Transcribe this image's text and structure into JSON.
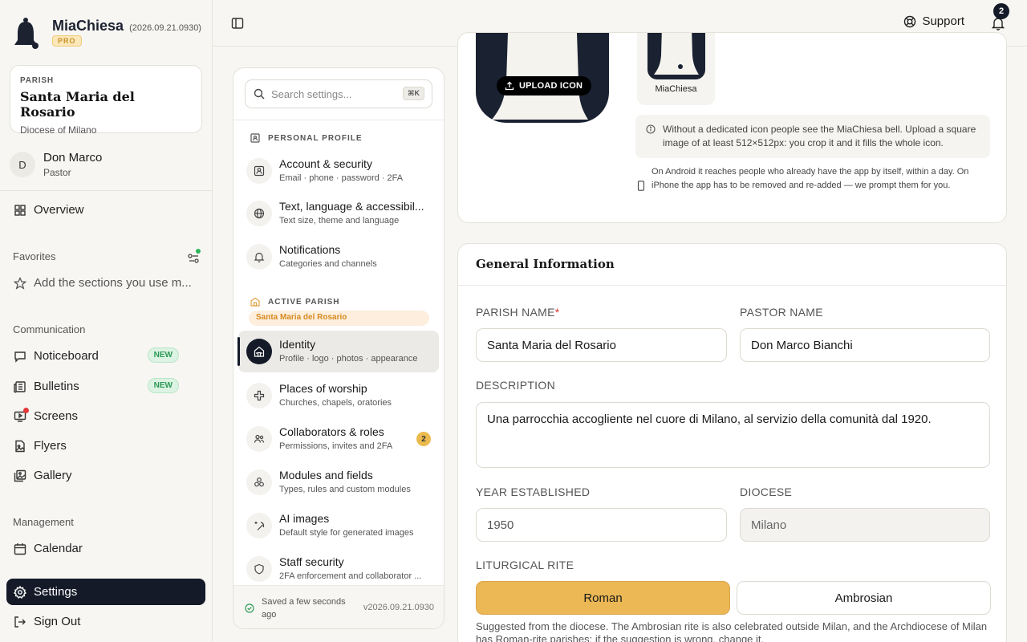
{
  "brand": {
    "name": "MiaChiesa",
    "version": "(2026.09.21.0930)",
    "badge": "PRO"
  },
  "parish_card": {
    "label": "PARISH",
    "name": "Santa Maria del Rosario",
    "diocese": "Diocese of Milano"
  },
  "user": {
    "initial": "D",
    "name": "Don Marco",
    "role": "Pastor"
  },
  "nav": {
    "overview": "Overview",
    "favorites_label": "Favorites",
    "favorites_hint": "Add the sections you use m...",
    "communication_label": "Communication",
    "noticeboard": "Noticeboard",
    "bulletins": "Bulletins",
    "new_badge": "NEW",
    "screens": "Screens",
    "flyers": "Flyers",
    "gallery": "Gallery",
    "management_label": "Management",
    "calendar": "Calendar",
    "settings": "Settings",
    "sign_out": "Sign Out"
  },
  "topbar": {
    "support": "Support",
    "notification_count": "2"
  },
  "settings_panel": {
    "search_placeholder": "Search settings...",
    "search_shortcut": "⌘K",
    "personal_label": "PERSONAL PROFILE",
    "active_parish_label": "ACTIVE PARISH",
    "active_parish_name": "Santa Maria del Rosario",
    "items": [
      {
        "title": "Account & security",
        "desc": "Email · phone · password · 2FA"
      },
      {
        "title": "Text, language & accessibil...",
        "desc": "Text size, theme and language"
      },
      {
        "title": "Notifications",
        "desc": "Categories and channels"
      },
      {
        "title": "Identity",
        "desc": "Profile · logo · photos · appearance"
      },
      {
        "title": "Places of worship",
        "desc": "Churches, chapels, oratories"
      },
      {
        "title": "Collaborators & roles",
        "desc": "Permissions, invites and 2FA",
        "count": "2"
      },
      {
        "title": "Modules and fields",
        "desc": "Types, rules and custom modules"
      },
      {
        "title": "AI images",
        "desc": "Default style for generated images"
      },
      {
        "title": "Staff security",
        "desc": "2FA enforcement and collaborator ..."
      }
    ],
    "saved_status": "Saved a few seconds ago",
    "version": "v2026.09.21.0930"
  },
  "icon_section": {
    "upload_label": "UPLOAD ICON",
    "preview_label": "MiaChiesa",
    "info_text": "Without a dedicated icon people see the MiaChiesa bell. Upload a square image of at least 512×512px: you crop it and it fills the whole icon.",
    "platform_note": "On Android it reaches people who already have the app by itself, within a day. On iPhone the app has to be removed and re-added — we prompt them for you."
  },
  "general": {
    "title": "General Information",
    "parish_name_label": "PARISH NAME",
    "parish_name_required": "*",
    "parish_name_value": "Santa Maria del Rosario",
    "pastor_name_label": "PASTOR NAME",
    "pastor_name_value": "Don Marco Bianchi",
    "description_label": "DESCRIPTION",
    "description_value": "Una parrocchia accogliente nel cuore di Milano, al servizio della comunità dal 1920.",
    "year_label": "YEAR ESTABLISHED",
    "year_value": "1950",
    "diocese_label": "DIOCESE",
    "diocese_value": "Milano",
    "rite_label": "LITURGICAL RITE",
    "rite_options": [
      "Roman",
      "Ambrosian"
    ],
    "rite_note": "Suggested from the diocese. The Ambrosian rite is also celebrated outside Milan, and the Archdiocese of Milan has Roman-rite parishes: if the suggestion is wrong, change it."
  },
  "colors": {
    "navy": "#141a28",
    "gold": "#ebb855",
    "green": "#2e9a55",
    "red": "#e53a3a"
  }
}
